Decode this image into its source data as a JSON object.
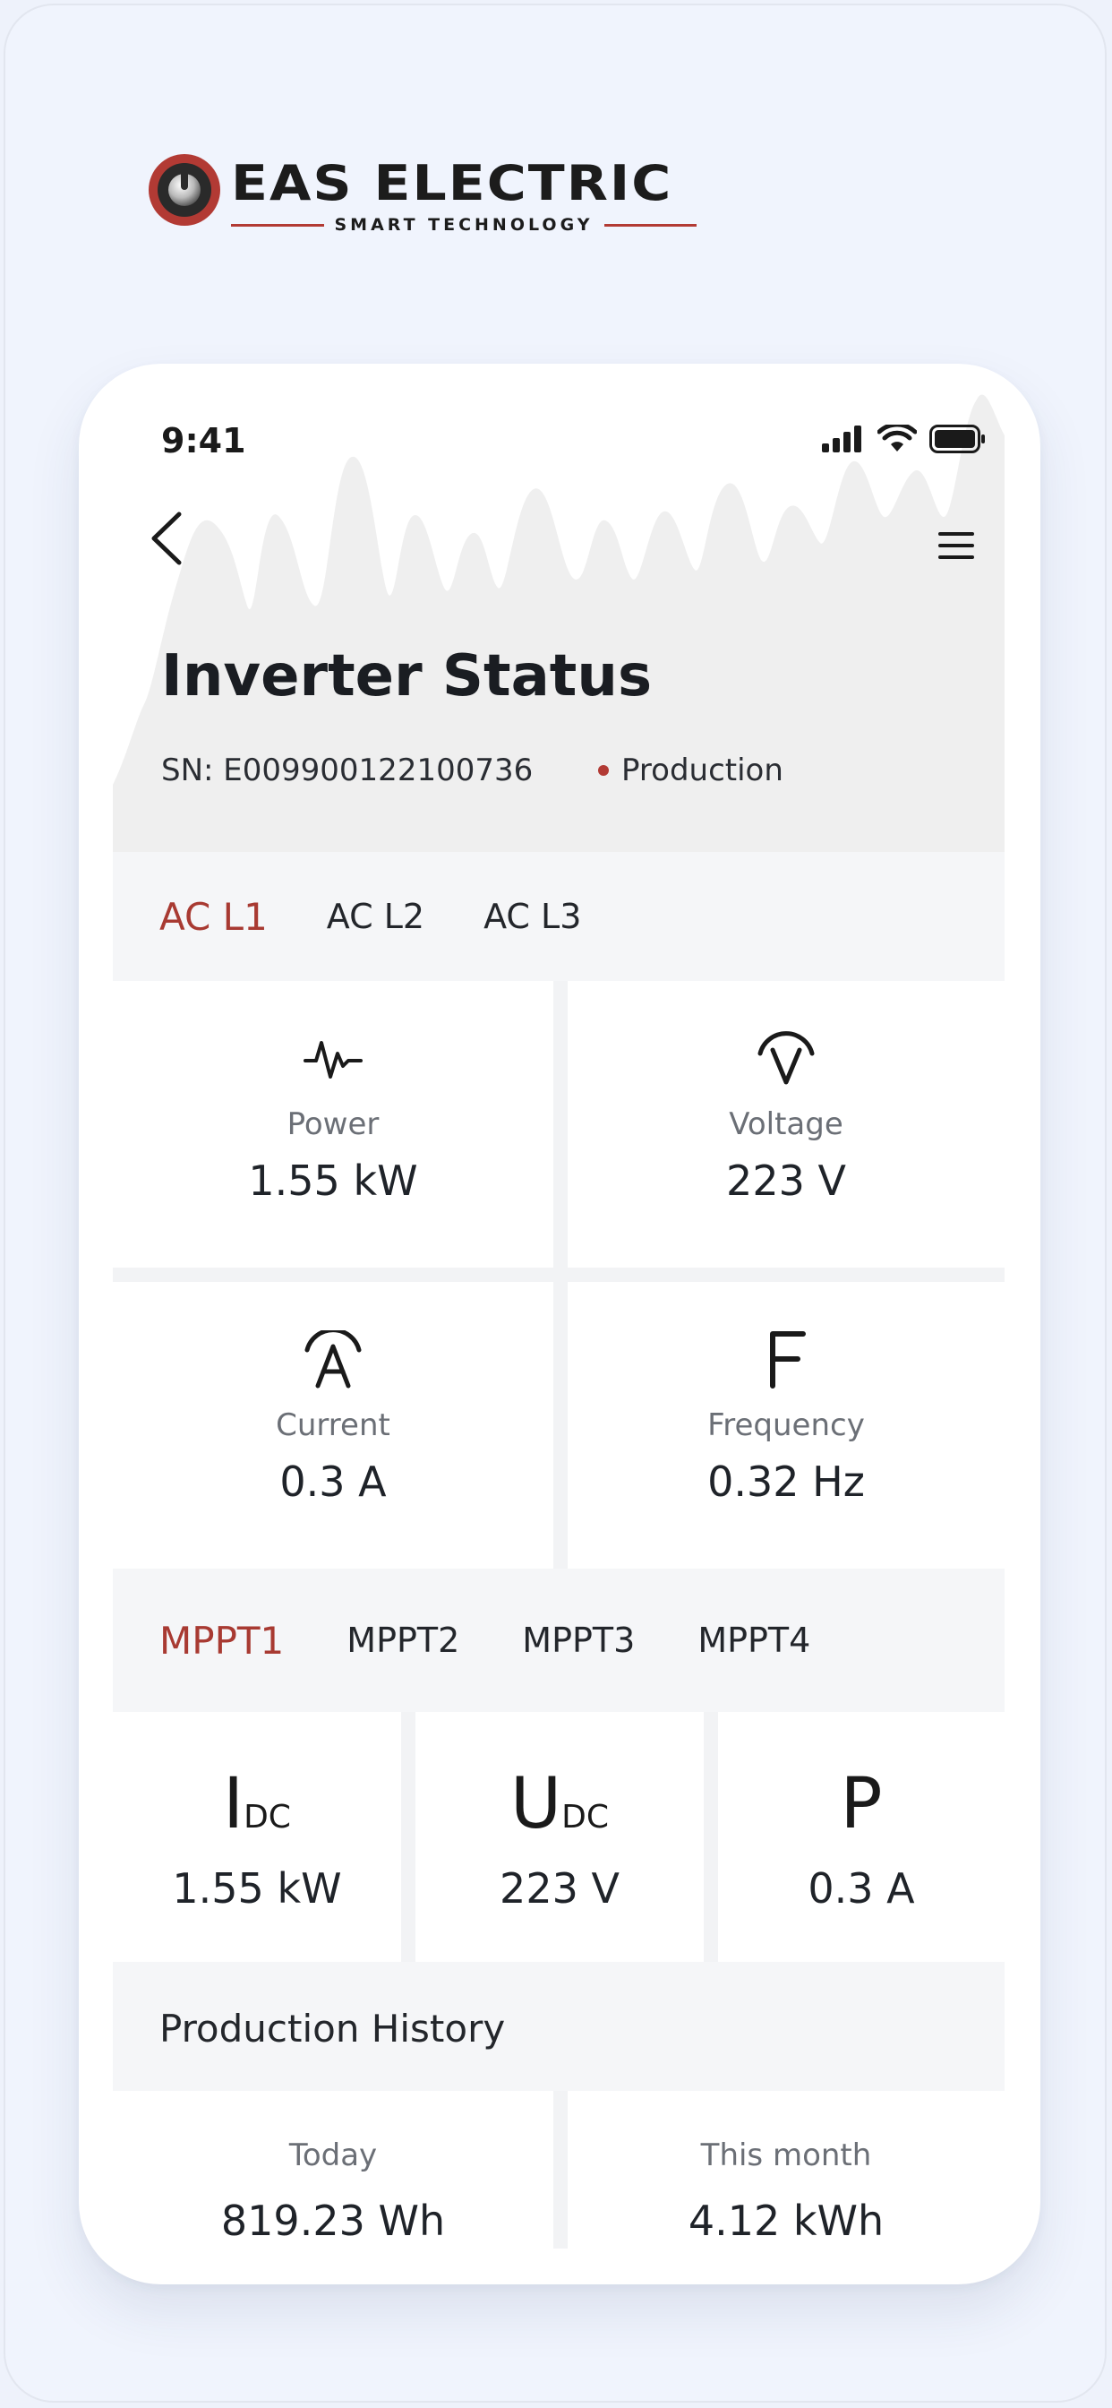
{
  "brand": {
    "name": "EAS ELECTRIC",
    "tagline": "SMART TECHNOLOGY",
    "accent": "#B23A34"
  },
  "status_bar": {
    "time": "9:41",
    "icons": [
      "signal-icon",
      "wifi-icon",
      "battery-icon"
    ]
  },
  "nav": {
    "back_icon": "chevron-left-icon",
    "menu_icon": "hamburger-menu-icon"
  },
  "header": {
    "title": "Inverter Status",
    "serial": "SN: E009900122100736",
    "state": "Production"
  },
  "ac_tabs": [
    {
      "label": "AC L1",
      "active": true
    },
    {
      "label": "AC L2",
      "active": false
    },
    {
      "label": "AC L3",
      "active": false
    }
  ],
  "ac_metrics": [
    {
      "icon": "pulse-icon",
      "label": "Power",
      "value": "1.55 kW"
    },
    {
      "icon": "voltage-icon",
      "label": "Voltage",
      "value": "223 V"
    },
    {
      "icon": "current-icon",
      "label": "Current",
      "value": "0.3 A"
    },
    {
      "icon": "frequency-icon",
      "label": "Frequency",
      "value": "0.32 Hz"
    }
  ],
  "mppt_tabs": [
    {
      "label": "MPPT1",
      "active": true
    },
    {
      "label": "MPPT2",
      "active": false
    },
    {
      "label": "MPPT3",
      "active": false
    },
    {
      "label": "MPPT4",
      "active": false
    }
  ],
  "mppt_metrics": [
    {
      "symbol": "I",
      "sub": "DC",
      "value": "1.55 kW"
    },
    {
      "symbol": "U",
      "sub": "DC",
      "value": "223 V"
    },
    {
      "symbol": "P",
      "sub": "",
      "value": "0.3 A"
    }
  ],
  "history": {
    "title": "Production History",
    "items": [
      {
        "label": "Today",
        "value": "819.23 Wh"
      },
      {
        "label": "This month",
        "value": "4.12 kWh"
      }
    ]
  }
}
